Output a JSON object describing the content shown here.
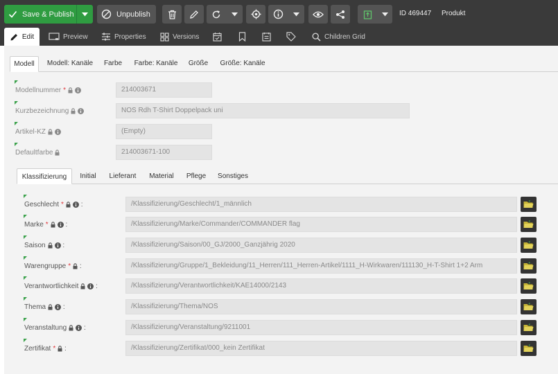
{
  "toolbar": {
    "save_publish_label": "Save & Publish",
    "unpublish_label": "Unpublish",
    "id_label": "ID 469447",
    "class_label": "Produkt",
    "icons": [
      "check-icon",
      "chevron-down-icon",
      "prohibit-icon",
      "trash-icon",
      "pencil-icon",
      "reload-icon",
      "chevron-down-icon",
      "target-icon",
      "info-icon",
      "chevron-down-icon",
      "eye-icon",
      "share-icon",
      "clipboard-icon",
      "chevron-down-icon"
    ]
  },
  "view_tabs": [
    {
      "label": "Edit",
      "icon": "pencil-icon"
    },
    {
      "label": "Preview",
      "icon": "preview-icon"
    },
    {
      "label": "Properties",
      "icon": "sliders-icon"
    },
    {
      "label": "Versions",
      "icon": "grid-icon"
    },
    {
      "label": "",
      "icon": "calendar-check-icon"
    },
    {
      "label": "",
      "icon": "bookmark-icon"
    },
    {
      "label": "",
      "icon": "notes-icon"
    },
    {
      "label": "",
      "icon": "tag-icon"
    },
    {
      "label": "Children Grid",
      "icon": "search-icon"
    }
  ],
  "tabs": [
    "Modell",
    "Modell: Kanäle",
    "Farbe",
    "Farbe: Kanäle",
    "Größe",
    "Größe: Kanäle"
  ],
  "fields": [
    {
      "label": "Modellnummer",
      "required": true,
      "info": true,
      "value": "214003671"
    },
    {
      "label": "Kurzbezeichnung",
      "required": false,
      "info": true,
      "value": "NOS Rdh T-Shirt Doppelpack uni"
    },
    {
      "label": "Artikel-KZ",
      "required": false,
      "info": true,
      "value": "(Empty)"
    },
    {
      "label": "Defaultfarbe",
      "required": false,
      "info": false,
      "value": "214003671-100"
    }
  ],
  "subtabs": [
    "Klassifizierung",
    "Initial",
    "Lieferant",
    "Material",
    "Pflege",
    "Sonstiges"
  ],
  "klassifizierung": [
    {
      "label": "Geschlecht",
      "required": true,
      "info": true,
      "value": "/Klassifizierung/Geschlecht/1_männlich"
    },
    {
      "label": "Marke",
      "required": true,
      "info": true,
      "value": "/Klassifizierung/Marke/Commander/COMMANDER flag"
    },
    {
      "label": "Saison",
      "required": false,
      "info": true,
      "value": "/Klassifizierung/Saison/00_GJ/2000_Ganzjährig 2020"
    },
    {
      "label": "Warengruppe",
      "required": true,
      "info": false,
      "value": "/Klassifizierung/Gruppe/1_Bekleidung/11_Herren/111_Herren-Artikel/1111_H-Wirkwaren/111130_H-T-Shirt 1+2 Arm"
    },
    {
      "label": "Verantwortlichkeit",
      "required": false,
      "info": true,
      "value": "/Klassifizierung/Verantwortlichkeit/KAE14000/2143"
    },
    {
      "label": "Thema",
      "required": false,
      "info": true,
      "value": "/Klassifizierung/Thema/NOS"
    },
    {
      "label": "Veranstaltung",
      "required": false,
      "info": true,
      "value": "/Klassifizierung/Veranstaltung/9211001"
    },
    {
      "label": "Zertifikat",
      "required": true,
      "info": false,
      "value": "/Klassifizierung/Zertifikat/000_kein Zertifikat"
    }
  ],
  "colors": {
    "accent": "#2f9c41",
    "toolbar": "#3a3a3a",
    "required": "#e0393e",
    "folder": "#c7b636"
  }
}
